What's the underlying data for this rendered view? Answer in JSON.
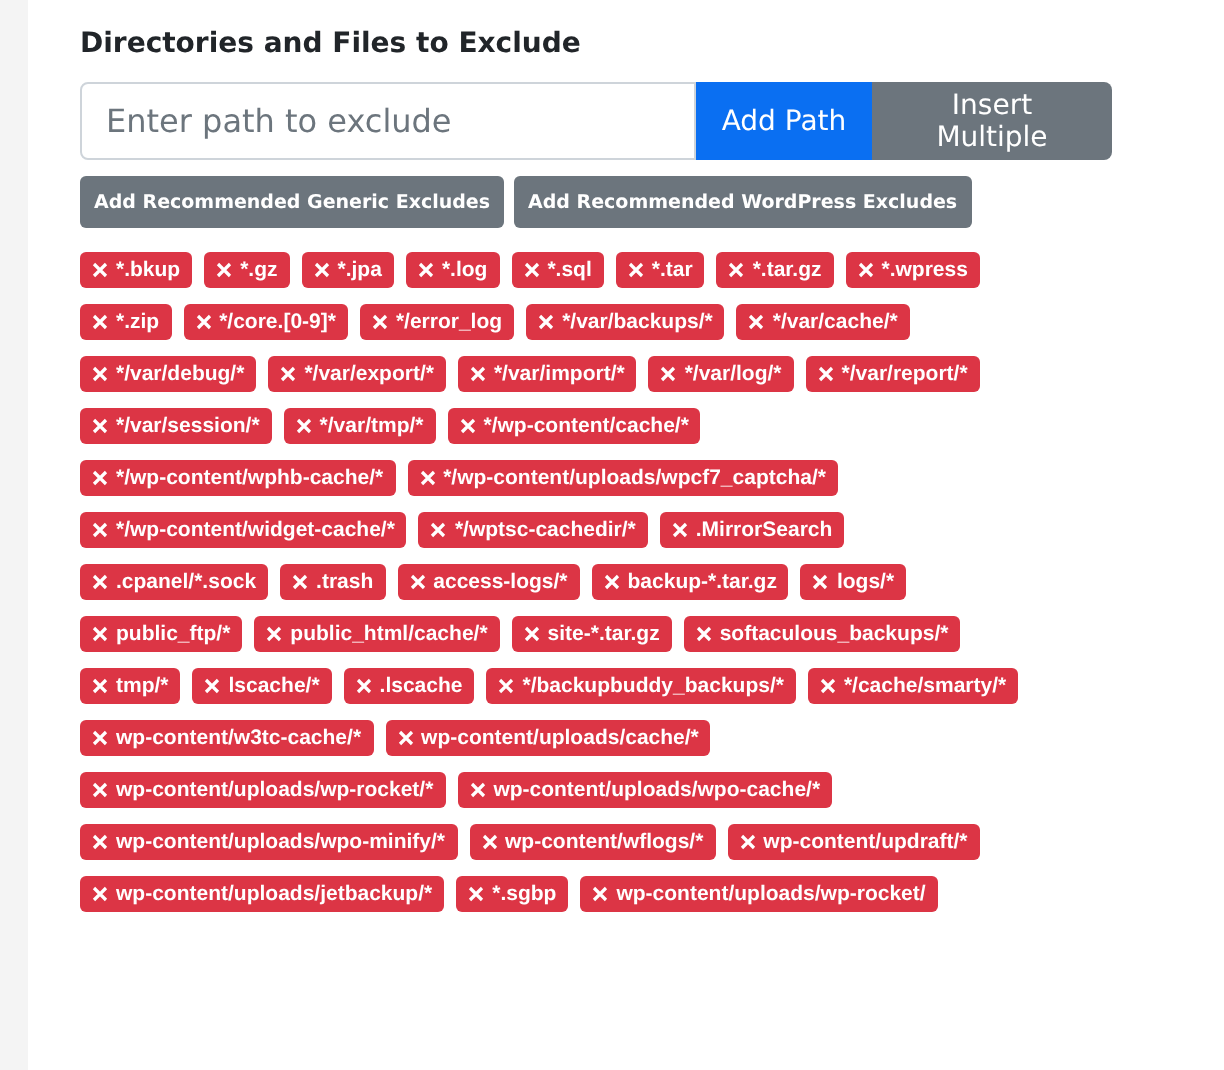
{
  "section": {
    "title": "Directories and Files to Exclude"
  },
  "path_input": {
    "placeholder": "Enter path to exclude"
  },
  "buttons": [
    {
      "label": "Add Path",
      "kind": "primary"
    },
    {
      "label": "Insert Multiple",
      "kind": "secondary"
    }
  ],
  "recommend_buttons": [
    "Add Recommended Generic Excludes",
    "Add Recommended WordPress Excludes"
  ],
  "excludes": [
    "*.bkup",
    "*.gz",
    "*.jpa",
    "*.log",
    "*.sql",
    "*.tar",
    "*.tar.gz",
    "*.wpress",
    "*.zip",
    "*/core.[0-9]*",
    "*/error_log",
    "*/var/backups/*",
    "*/var/cache/*",
    "*/var/debug/*",
    "*/var/export/*",
    "*/var/import/*",
    "*/var/log/*",
    "*/var/report/*",
    "*/var/session/*",
    "*/var/tmp/*",
    "*/wp-content/cache/*",
    "*/wp-content/wphb-cache/*",
    "*/wp-content/uploads/wpcf7_captcha/*",
    "*/wp-content/widget-cache/*",
    "*/wptsc-cachedir/*",
    ".MirrorSearch",
    ".cpanel/*.sock",
    ".trash",
    "access-logs/*",
    "backup-*.tar.gz",
    "logs/*",
    "public_ftp/*",
    "public_html/cache/*",
    "site-*.tar.gz",
    "softaculous_backups/*",
    "tmp/*",
    "lscache/*",
    ".lscache",
    "*/backupbuddy_backups/*",
    "*/cache/smarty/*",
    "wp-content/w3tc-cache/*",
    "wp-content/uploads/cache/*",
    "wp-content/uploads/wp-rocket/*",
    "wp-content/uploads/wpo-cache/*",
    "wp-content/uploads/wpo-minify/*",
    "wp-content/wflogs/*",
    "wp-content/updraft/*",
    "wp-content/uploads/jetbackup/*",
    "*.sgbp",
    "wp-content/uploads/wp-rocket/"
  ]
}
